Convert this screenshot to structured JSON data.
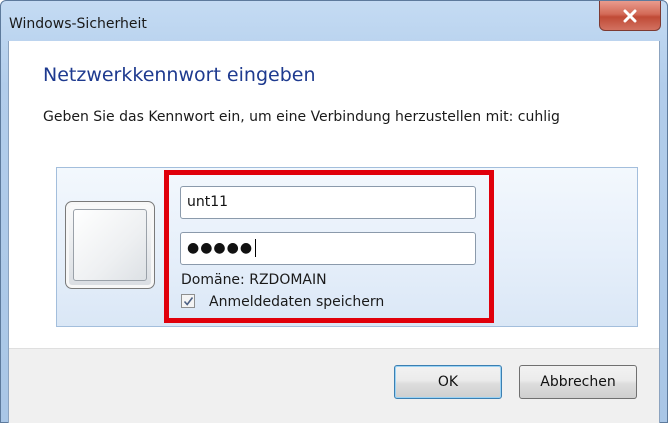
{
  "window": {
    "title": "Windows-Sicherheit",
    "close_icon": "close-icon"
  },
  "dialog": {
    "heading": "Netzwerkkennwort eingeben",
    "subheading": "Geben Sie das Kennwort ein, um eine Verbindung herzustellen mit: cuhlig"
  },
  "credentials": {
    "avatar_icon": "user-tile-icon",
    "username_value": "unt11",
    "password_masked": "●●●●●",
    "domain_text": "Domäne: RZDOMAIN",
    "remember_label": "Anmeldedaten speichern",
    "remember_checked": true,
    "highlight_color": "#e0000b"
  },
  "buttons": {
    "ok_label": "OK",
    "cancel_label": "Abbrechen"
  }
}
